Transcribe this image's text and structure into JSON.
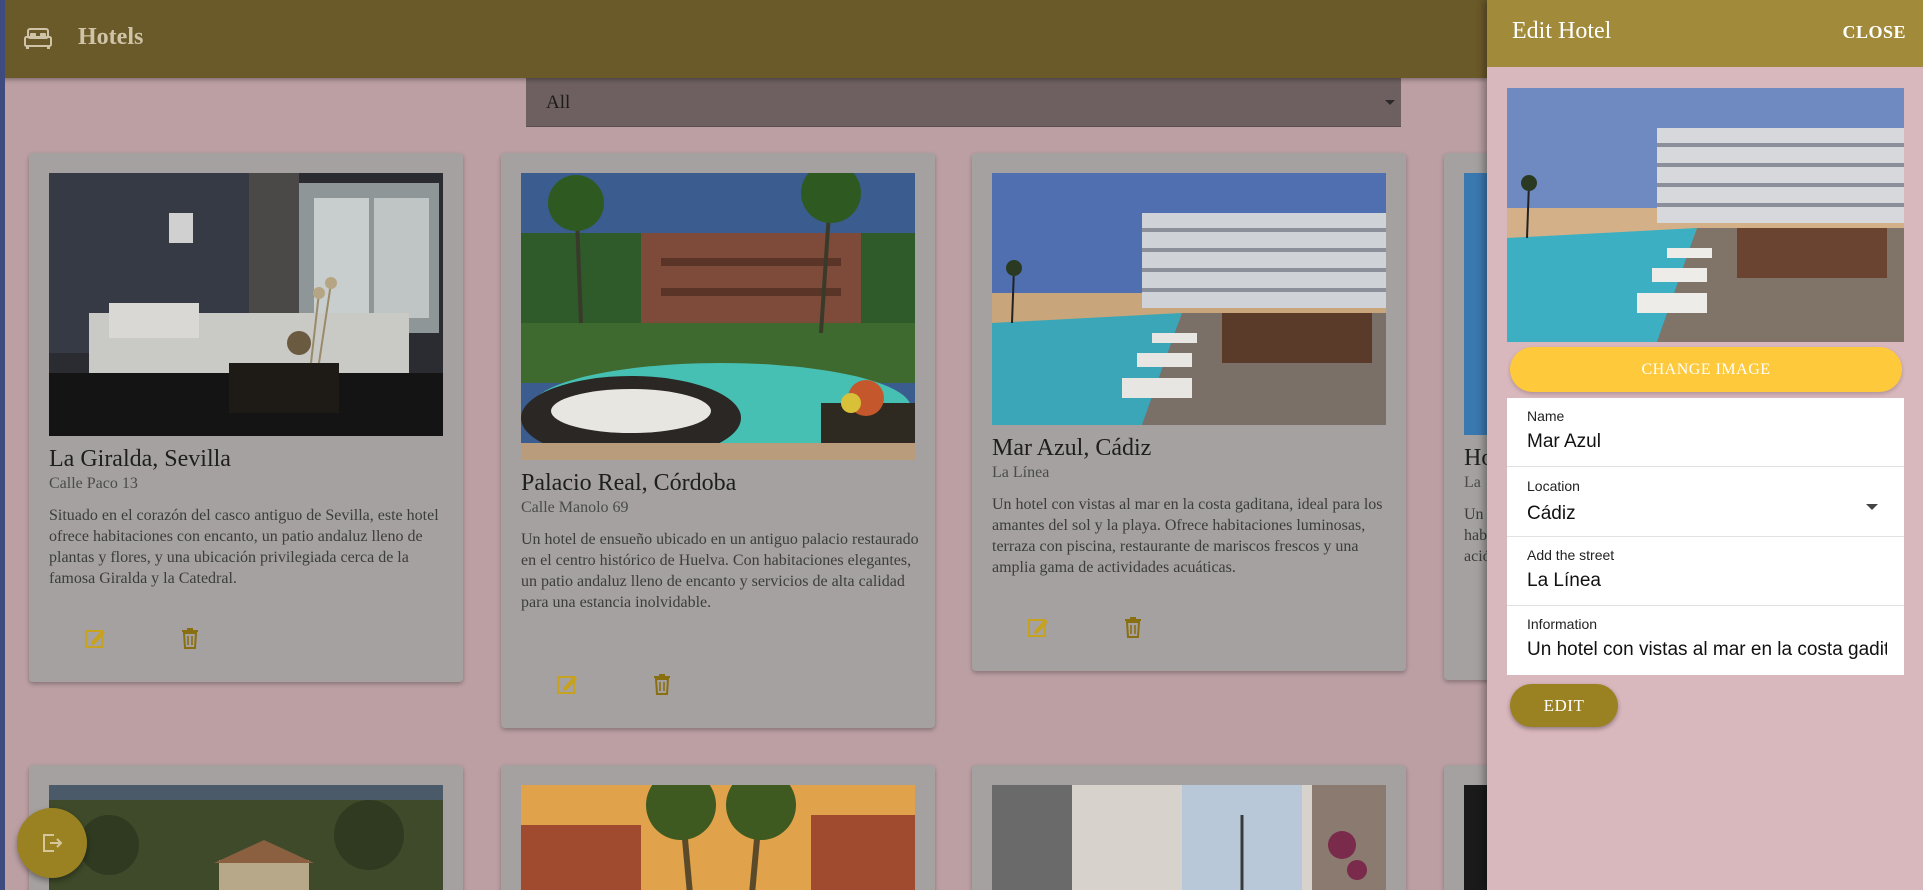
{
  "app": {
    "title": "Hotels",
    "bed_icon": "bed-icon"
  },
  "filter": {
    "value": "All"
  },
  "hotels": [
    {
      "name": "La Giralda, Sevilla",
      "street": "Calle Paco 13",
      "description": "Situado en el corazón del casco antiguo de Sevilla, este hotel ofrece habitaciones con encanto, un patio andaluz lleno de plantas y flores, y una ubicación privilegiada cerca de la famosa Giralda y la Catedral."
    },
    {
      "name": "Palacio Real, Córdoba",
      "street": "Calle Manolo 69",
      "description": "Un hotel de ensueño ubicado en un antiguo palacio restaurado en el centro histórico de Huelva. Con habitaciones elegantes, un patio andaluz lleno de encanto y servicios de alta calidad para una estancia inolvidable."
    },
    {
      "name": "Mar Azul, Cádiz",
      "street": "La Línea",
      "description": "Un hotel con vistas al mar en la costa gaditana, ideal para los amantes del sol y la playa. Ofrece habitaciones luminosas, terraza con piscina, restaurante de mariscos frescos y una amplia gama de actividades acuáticas."
    },
    {
      "name": "Ho",
      "street": "La",
      "description": "Un hab ació"
    }
  ],
  "drawer": {
    "title": "Edit Hotel",
    "close_label": "CLOSE",
    "change_image_label": "CHANGE IMAGE",
    "edit_label": "EDIT",
    "fields": {
      "name": {
        "label": "Name",
        "value": "Mar Azul"
      },
      "location": {
        "label": "Location",
        "value": "Cádiz"
      },
      "street": {
        "label": "Add the street",
        "value": "La Línea"
      },
      "information": {
        "label": "Information",
        "value": "Un hotel con vistas al mar en la costa gaditana, ideal para los amantes del sol y la playa."
      }
    }
  },
  "colors": {
    "appbar": "#6b5a29",
    "drawer_header": "#a18b3a",
    "accent_yellow": "#ffc93c",
    "edit_button": "#9a8222"
  }
}
